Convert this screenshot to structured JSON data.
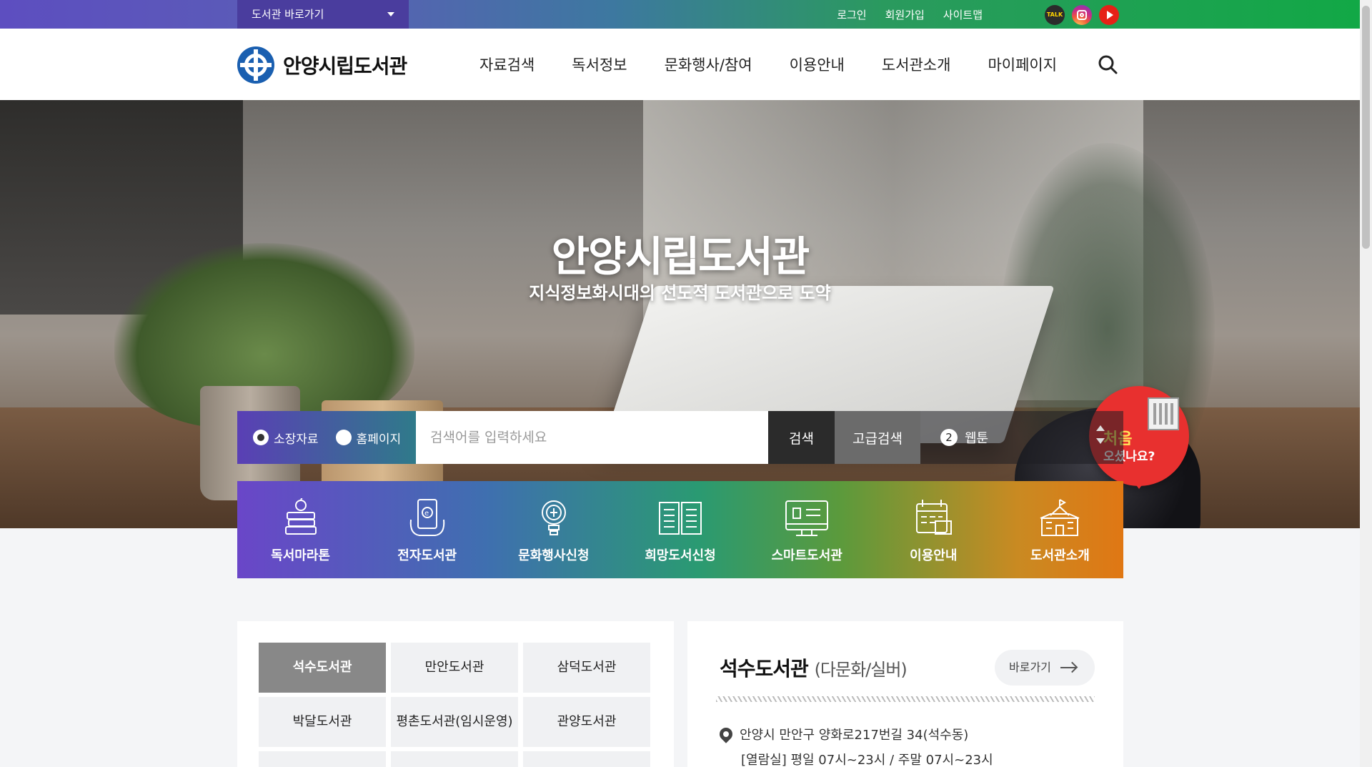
{
  "topbar": {
    "library_select": "도서관 바로가기",
    "links": [
      "로그인",
      "회원가입",
      "사이트맵"
    ],
    "social": [
      {
        "name": "kakaotalk",
        "label": "TALK"
      },
      {
        "name": "instagram"
      },
      {
        "name": "youtube"
      }
    ]
  },
  "header": {
    "logo_text": "안양시립도서관",
    "nav": [
      "자료검색",
      "독서정보",
      "문화행사/참여",
      "이용안내",
      "도서관소개",
      "마이페이지"
    ]
  },
  "hero": {
    "title": "안양시립도서관",
    "subtitle": "지식정보화시대의 선도적 도서관으로 도약",
    "first_visit": {
      "line1": "처음",
      "line2": "오셨나요?"
    }
  },
  "search": {
    "options": [
      {
        "label": "소장자료",
        "selected": true
      },
      {
        "label": "홈페이지",
        "selected": false
      }
    ],
    "placeholder": "검색어를 입력하세요",
    "search_label": "검색",
    "advanced_label": "고급검색",
    "trending": {
      "rank": "2",
      "keyword": "웹툰"
    }
  },
  "quick_menu": [
    {
      "label": "독서마라톤",
      "icon": "books-icon"
    },
    {
      "label": "전자도서관",
      "icon": "ebook-icon"
    },
    {
      "label": "문화행사신청",
      "icon": "lightbulb-icon"
    },
    {
      "label": "희망도서신청",
      "icon": "open-book-icon"
    },
    {
      "label": "스마트도서관",
      "icon": "smart-library-icon"
    },
    {
      "label": "이용안내",
      "icon": "calendar-icon"
    },
    {
      "label": "도서관소개",
      "icon": "school-building-icon"
    }
  ],
  "branches": {
    "tabs": [
      "석수도서관",
      "만안도서관",
      "삼덕도서관",
      "박달도서관",
      "평촌도서관(임시운영)",
      "관양도서관",
      "",
      "",
      ""
    ],
    "active": 0
  },
  "branch_info": {
    "name": "석수도서관",
    "type": "(다문화/실버)",
    "goto_label": "바로가기",
    "address": "안양시 만안구 양화로217번길 34(석수동)",
    "hours": "[열람실] 평일 07시~23시 / 주말 07시~23시"
  },
  "colors": {
    "topbar_start": "#5d4ec0",
    "topbar_end": "#12a846",
    "first_visit_badge": "#e8302f",
    "active_tab": "#888888"
  }
}
